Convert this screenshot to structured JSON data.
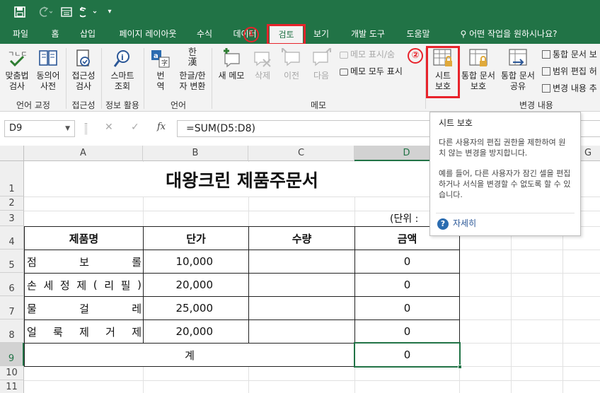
{
  "qat": {
    "save_icon": "save-icon",
    "redo_icon": "redo-icon",
    "form_icon": "form-icon",
    "undo_icon": "undo-icon",
    "customize_icon": "customize-qat-icon"
  },
  "tabs": [
    {
      "label": "파일"
    },
    {
      "label": "홈"
    },
    {
      "label": "삽입"
    },
    {
      "label": "페이지 레이아웃"
    },
    {
      "label": "수식"
    },
    {
      "label": "데이터"
    },
    {
      "label": "검토"
    },
    {
      "label": "보기"
    },
    {
      "label": "개발 도구"
    },
    {
      "label": "도움말"
    },
    {
      "label": "어떤 작업을 원하시나요?"
    }
  ],
  "annotations": {
    "step1": "①",
    "step2": "②"
  },
  "ribbon": {
    "spell_check": "맞춤법\n검사",
    "thesaurus": "동의어\n사전",
    "accessibility": "접근성\n검사",
    "smart_lookup": "스마트\n조회",
    "translate": "번\n역",
    "hanja": "한글/한\n자 변환",
    "new_comment": "새 메모",
    "delete": "삭제",
    "previous": "이전",
    "next": "다음",
    "show_hide_comment": "메모 표시/숨",
    "show_all_comments": "메모 모두 표시",
    "protect_sheet": "시트\n보호",
    "protect_workbook": "통합 문서\n보호",
    "share_workbook": "통합 문서\n공유",
    "protect_share": "통합 문서 보",
    "allow_edit_ranges": "범위 편집 허",
    "track_changes": "변경 내용 추",
    "hanja_icon_text": "한\n漢",
    "groups": {
      "proofing": "언어 교정",
      "accessibility": "접근성",
      "insights": "정보 활용",
      "language": "언어",
      "comments": "메모",
      "changes": "변경 내용"
    }
  },
  "formula_bar": {
    "name_box": "D9",
    "cancel": "✕",
    "enter": "✓",
    "fx": "fx",
    "formula": "=SUM(D5:D8)"
  },
  "grid": {
    "columns": [
      "A",
      "B",
      "C",
      "D",
      "E",
      "F",
      "G"
    ],
    "rows": [
      "1",
      "2",
      "3",
      "4",
      "5",
      "6",
      "7",
      "8",
      "9",
      "10",
      "11"
    ],
    "selected_cell": "D9",
    "title": "대왕크린 제품주문서",
    "unit_note": "(단위 : ",
    "headers": [
      "제품명",
      "단가",
      "수량",
      "금액"
    ],
    "items": [
      {
        "name": [
          "점",
          "보",
          "롤"
        ],
        "price": "10,000",
        "qty": "",
        "amount": "0"
      },
      {
        "name": [
          "손",
          "세",
          "정",
          "제",
          "(",
          "리",
          "필",
          ")"
        ],
        "price": "20,000",
        "qty": "",
        "amount": "0"
      },
      {
        "name": [
          "물",
          "걸",
          "레"
        ],
        "price": "25,000",
        "qty": "",
        "amount": "0"
      },
      {
        "name": [
          "얼",
          "룩",
          "제",
          "거",
          "제"
        ],
        "price": "20,000",
        "qty": "",
        "amount": "0"
      }
    ],
    "total_label": "계",
    "total_amount": "0"
  },
  "tooltip": {
    "title": "시트 보호",
    "p1": "다른 사용자의 편집 권한을 제한하여 원치 않는 변경을 방지합니다.",
    "p2": "예를 들어, 다른 사용자가 잠긴 셀을 편집하거나 서식을 변경할 수 없도록 할 수 있습니다.",
    "more": "자세히"
  },
  "colors": {
    "excel_green": "#217346",
    "highlight_red": "#e8232b",
    "link_blue": "#2b5797"
  }
}
